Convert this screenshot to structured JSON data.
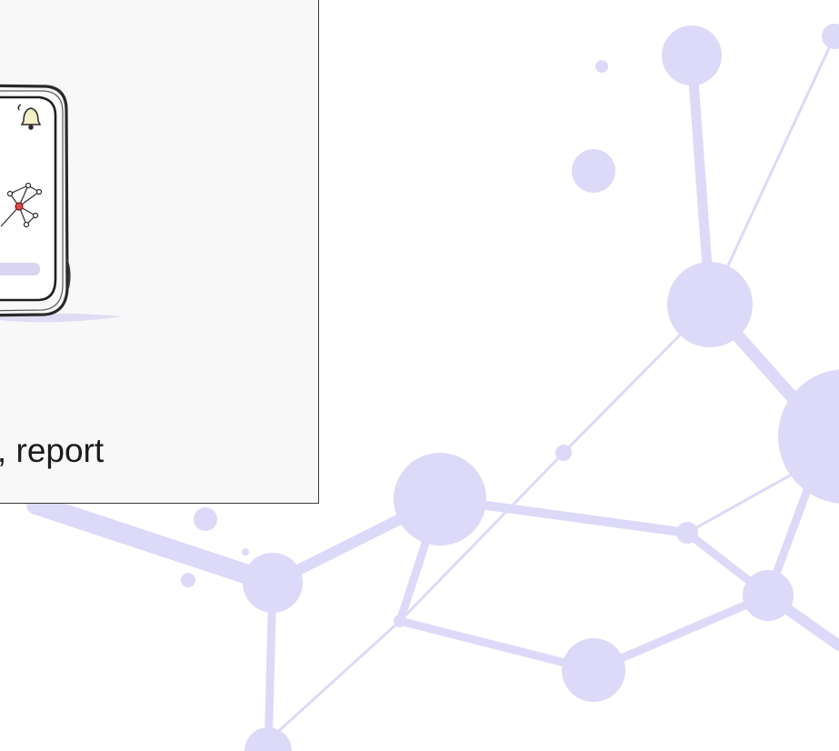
{
  "background": {
    "color": "#ffffff",
    "network_color": "#ddd9f8",
    "icon": "network-graph-decoration"
  },
  "feature_card": {
    "background_color": "#f8f8f8",
    "border_color": "#3a3a3a",
    "illustration_icon": "device-with-network-and-bell-illustration",
    "caption": "nitor, report"
  }
}
